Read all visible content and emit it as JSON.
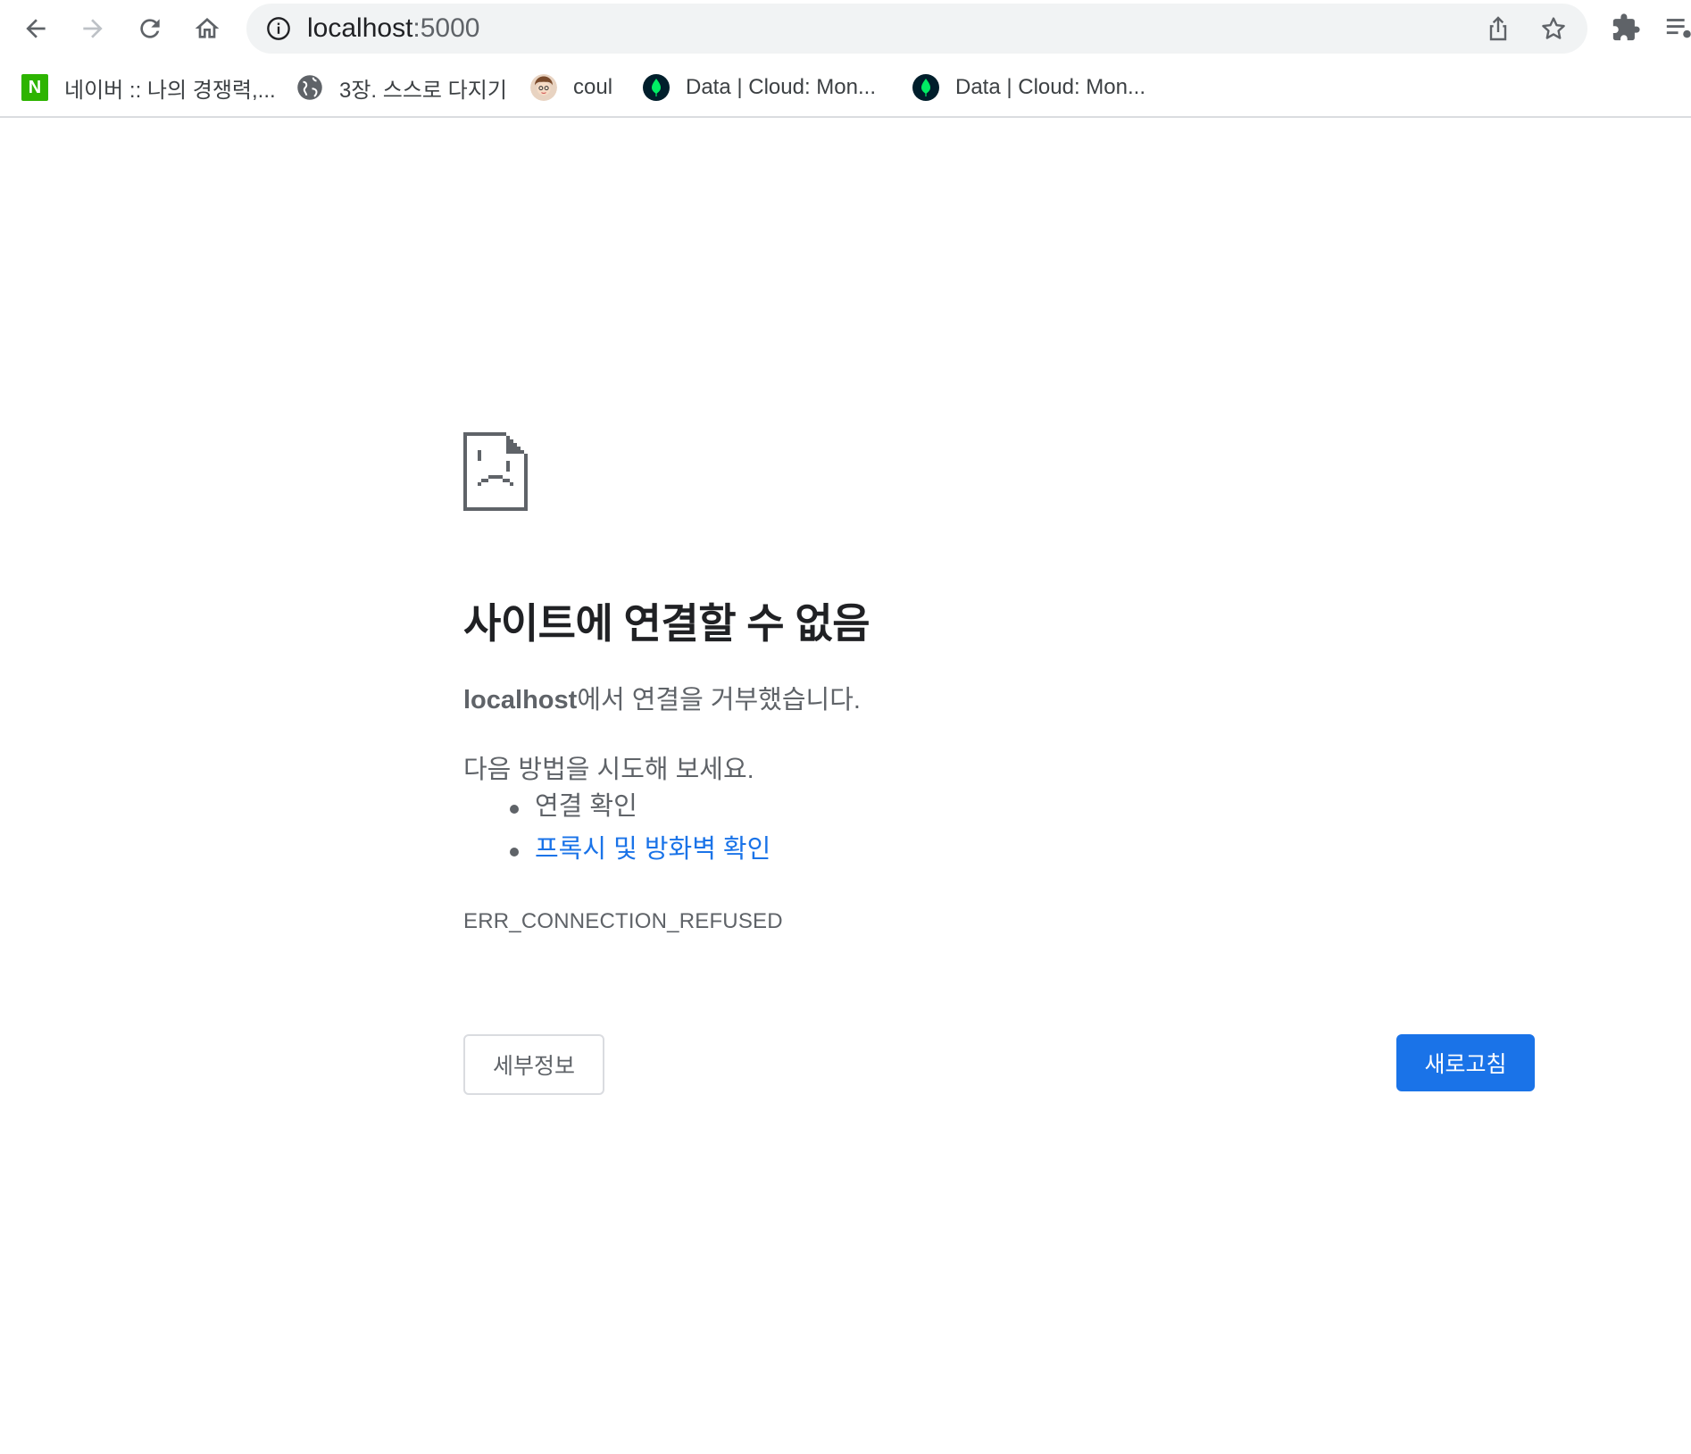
{
  "browser": {
    "url_host": "localhost",
    "url_port": ":5000"
  },
  "bookmarks": [
    {
      "label": "네이버 :: 나의 경쟁력,...",
      "icon": "naver-favicon",
      "icon_text": "N"
    },
    {
      "label": "3장. 스스로 다지기",
      "icon": "globe-icon"
    },
    {
      "label": "coul",
      "icon": "avatar-favicon"
    },
    {
      "label": "Data | Cloud: Mon...",
      "icon": "mongodb-leaf-icon"
    },
    {
      "label": "Data | Cloud: Mon...",
      "icon": "mongodb-leaf-icon"
    }
  ],
  "error": {
    "icon": "sad-page-icon",
    "title": "사이트에 연결할 수 없음",
    "desc_host": "localhost",
    "desc_rest": "에서 연결을 거부했습니다.",
    "suggest_head": "다음 방법을 시도해 보세요.",
    "suggestions": [
      "연결 확인",
      "프록시 및 방화벽 확인"
    ],
    "code": "ERR_CONNECTION_REFUSED",
    "details_label": "세부정보",
    "reload_label": "새로고침"
  },
  "colors": {
    "accent": "#1a73e8",
    "text_primary": "#202124",
    "text_secondary": "#5f6368",
    "naver_green": "#2db400"
  }
}
